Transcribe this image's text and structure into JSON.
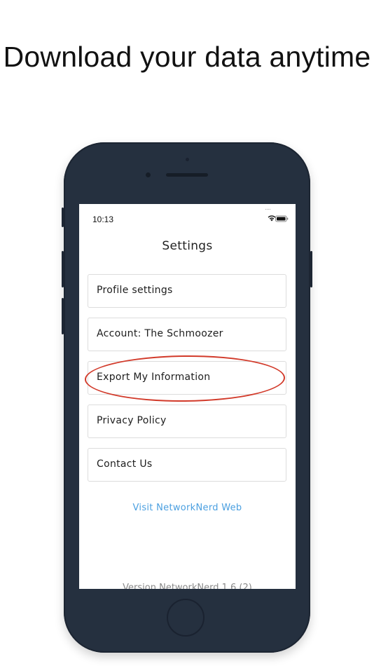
{
  "headline": "Download your data anytime",
  "status_bar": {
    "time": "10:13",
    "icons": [
      "wifi-icon",
      "battery-icon"
    ]
  },
  "nav": {
    "title": "Settings"
  },
  "menu": {
    "items": [
      {
        "label": "Profile settings"
      },
      {
        "label": "Account: The Schmoozer"
      },
      {
        "label": "Export My Information"
      },
      {
        "label": "Privacy Policy"
      },
      {
        "label": "Contact Us"
      }
    ]
  },
  "links": {
    "web": "Visit NetworkNerd Web"
  },
  "footer": {
    "version_partial": "Version NetworkNerd 1.6 (2)"
  },
  "colors": {
    "phone_body": "#25303f",
    "link": "#4a9fe0",
    "highlight": "#d23a2a"
  }
}
